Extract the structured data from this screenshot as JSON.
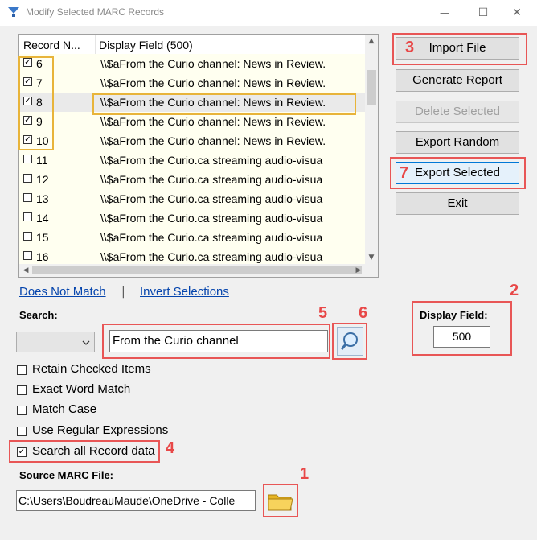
{
  "window": {
    "title": "Modify Selected MARC Records",
    "minimize": "—",
    "maximize": "☐",
    "close": "✕"
  },
  "list": {
    "headers": {
      "record_number": "Record N...",
      "display_field": "Display Field (500)"
    },
    "rows": [
      {
        "id": "6",
        "checked": true,
        "text": "\\\\$aFrom the Curio channel: News in Review."
      },
      {
        "id": "7",
        "checked": true,
        "text": "\\\\$aFrom the Curio channel: News in Review."
      },
      {
        "id": "8",
        "checked": true,
        "text": "\\\\$aFrom the Curio channel: News in Review."
      },
      {
        "id": "9",
        "checked": true,
        "text": "\\\\$aFrom the Curio channel: News in Review."
      },
      {
        "id": "10",
        "checked": true,
        "text": "\\\\$aFrom the Curio channel: News in Review."
      },
      {
        "id": "11",
        "checked": false,
        "text": "\\\\$aFrom the Curio.ca streaming audio-visua"
      },
      {
        "id": "12",
        "checked": false,
        "text": "\\\\$aFrom the Curio.ca streaming audio-visua"
      },
      {
        "id": "13",
        "checked": false,
        "text": "\\\\$aFrom the Curio.ca streaming audio-visua"
      },
      {
        "id": "14",
        "checked": false,
        "text": "\\\\$aFrom the Curio.ca streaming audio-visua"
      },
      {
        "id": "15",
        "checked": false,
        "text": "\\\\$aFrom the Curio.ca streaming audio-visua"
      },
      {
        "id": "16",
        "checked": false,
        "text": "\\\\$aFrom the Curio.ca streaming audio-visua"
      }
    ],
    "selected_row": "8"
  },
  "buttons": {
    "import_file": "Import File",
    "generate_report": "Generate Report",
    "delete_selected": "Delete Selected",
    "export_random": "Export Random",
    "export_selected": "Export Selected",
    "exit": "Exit"
  },
  "links": {
    "does_not_match": "Does Not Match",
    "separator": "|",
    "invert_selections": "Invert Selections"
  },
  "search": {
    "label": "Search:",
    "value": "From the Curio channel"
  },
  "display_field": {
    "label": "Display Field:",
    "value": "500"
  },
  "options": [
    {
      "label": "Retain Checked Items",
      "checked": false
    },
    {
      "label": "Exact Word Match",
      "checked": false
    },
    {
      "label": "Match Case",
      "checked": false
    },
    {
      "label": "Use Regular Expressions",
      "checked": false
    },
    {
      "label": "Search all Record data",
      "checked": true
    }
  ],
  "source": {
    "label": "Source MARC File:",
    "value": "C:\\Users\\BoudreauMaude\\OneDrive - Colle"
  },
  "annotations": [
    "1",
    "2",
    "3",
    "4",
    "5",
    "6",
    "7"
  ],
  "colors": {
    "callout_red": "#e85656",
    "callout_orange": "#e8b43a",
    "row_background": "#fffff0",
    "link": "#0645ad"
  }
}
